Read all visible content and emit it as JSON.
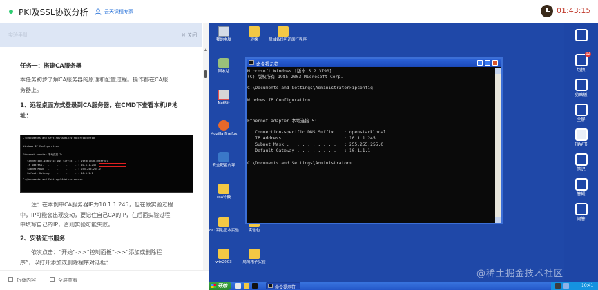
{
  "topbar": {
    "title": "PKI及SSL协议分析",
    "author": "云天课程专家",
    "timer": "01:43:15",
    "colors": {
      "status_dot": "#2ecc71",
      "timer": "#c0392b",
      "author": "#2a73d8"
    }
  },
  "left_panel": {
    "header_title": "实验手册",
    "close_label": "关闭",
    "task_title": "任务一：搭建CA服务器",
    "intro_lines": [
      "本任务初步了解CA服务器的原理和配置过程。操作都在CA服",
      "务器上。"
    ],
    "step1_title": [
      "1、远程桌面方式登录到CA服务器，在CMD下查看本机IP地",
      "址："
    ],
    "screenshot_lines": [
      "C:\\Documents and Settings\\Administrator>ipconfig",
      "",
      "Windows IP Configuration",
      "",
      "",
      "Ethernet adapter 本地连接 2:",
      "",
      "   Connection-specific DNS Suffix  . : yitdcloud.internal",
      "   IP Address. . . . . . . . . . . . : 10.1.1.245",
      "   Subnet Mask . . . . . . . . . . . : 255.255.255.0",
      "   Default Gateway . . . . . . . . . : 10.1.1.1",
      "",
      "C:\\Documents and Settings\\Administrator>"
    ],
    "note_lines": [
      "注：在本例中CA服务器IP为10.1.1.245，但在做实验过程",
      "中，IP可能会出现变动，要记住自己CA的IP，在后面实验过程",
      "中填写自己的IP，否则实验可能失败。"
    ],
    "step2_title": "2、安装证书服务",
    "step2_lines": [
      "依次点击：“开始”->>“控制面板”->>“添加或删除程",
      "序”，以打开添加或删除程序对话框："
    ],
    "bottom": {
      "collapse_label": "折叠内容",
      "fullscreen_label": "全屏查看"
    }
  },
  "desktop": {
    "icons": [
      {
        "label": "我的电脑",
        "kind": "computer"
      },
      {
        "label": "转换",
        "kind": "folder"
      },
      {
        "label": "局域备份可还原行程序",
        "kind": "folder"
      },
      {
        "label": "回收站",
        "kind": "recycle"
      },
      {
        "label": "NetBit",
        "kind": "netdir"
      },
      {
        "label": "Mozilla Firefox",
        "kind": "firefox"
      },
      {
        "label": "安全配置向导",
        "kind": "security"
      },
      {
        "label": "csa待嵌",
        "kind": "folder"
      },
      {
        "label": "ca1钥匙正本实验",
        "kind": "folder"
      },
      {
        "label": "实验包",
        "kind": "folder"
      },
      {
        "label": "win2003",
        "kind": "folder"
      },
      {
        "label": "局域电子实验",
        "kind": "folder"
      }
    ],
    "cmd": {
      "title": "命令提示符",
      "lines": [
        "Microsoft Windows [版本 5.2.3790]",
        "(C) 版权所有 1985-2003 Microsoft Corp.",
        "",
        "C:\\Documents and Settings\\Administrator>ipconfig",
        "",
        "Windows IP Configuration",
        "",
        "",
        "Ethernet adapter 本地连接 5:",
        "",
        "   Connection-specific DNS Suffix  . : openstacklocal",
        "   IP Address. . . . . . . . . . . . : 10.1.1.245",
        "   Subnet Mask . . . . . . . . . . . : 255.255.255.0",
        "   Default Gateway . . . . . . . . . : 10.1.1.1",
        "",
        "C:\\Documents and Settings\\Administrator>"
      ]
    },
    "taskbar": {
      "start_label": "开始",
      "task_label": "命令提示符",
      "clock": "10:41"
    },
    "colors": {
      "desktop_bg": "#1f48a8",
      "taskbar": "#2456c8",
      "start": "#3ea643"
    }
  },
  "toolbar": {
    "items": [
      {
        "label": "",
        "icon": "calendar-icon",
        "badge": ""
      },
      {
        "label": "切换",
        "icon": "switch-icon",
        "badge": "12"
      },
      {
        "label": "剪贴板",
        "icon": "scissors-icon",
        "badge": ""
      },
      {
        "label": "全屏",
        "icon": "fullscreen-icon",
        "badge": ""
      },
      {
        "label": "指导书",
        "icon": "book-icon",
        "badge": ""
      },
      {
        "label": "笔记",
        "icon": "pen-icon",
        "badge": ""
      },
      {
        "label": "答疑",
        "icon": "chat-icon",
        "badge": ""
      },
      {
        "label": "问答",
        "icon": "question-icon",
        "badge": ""
      }
    ]
  },
  "watermark": "@稀土掘金技术社区"
}
